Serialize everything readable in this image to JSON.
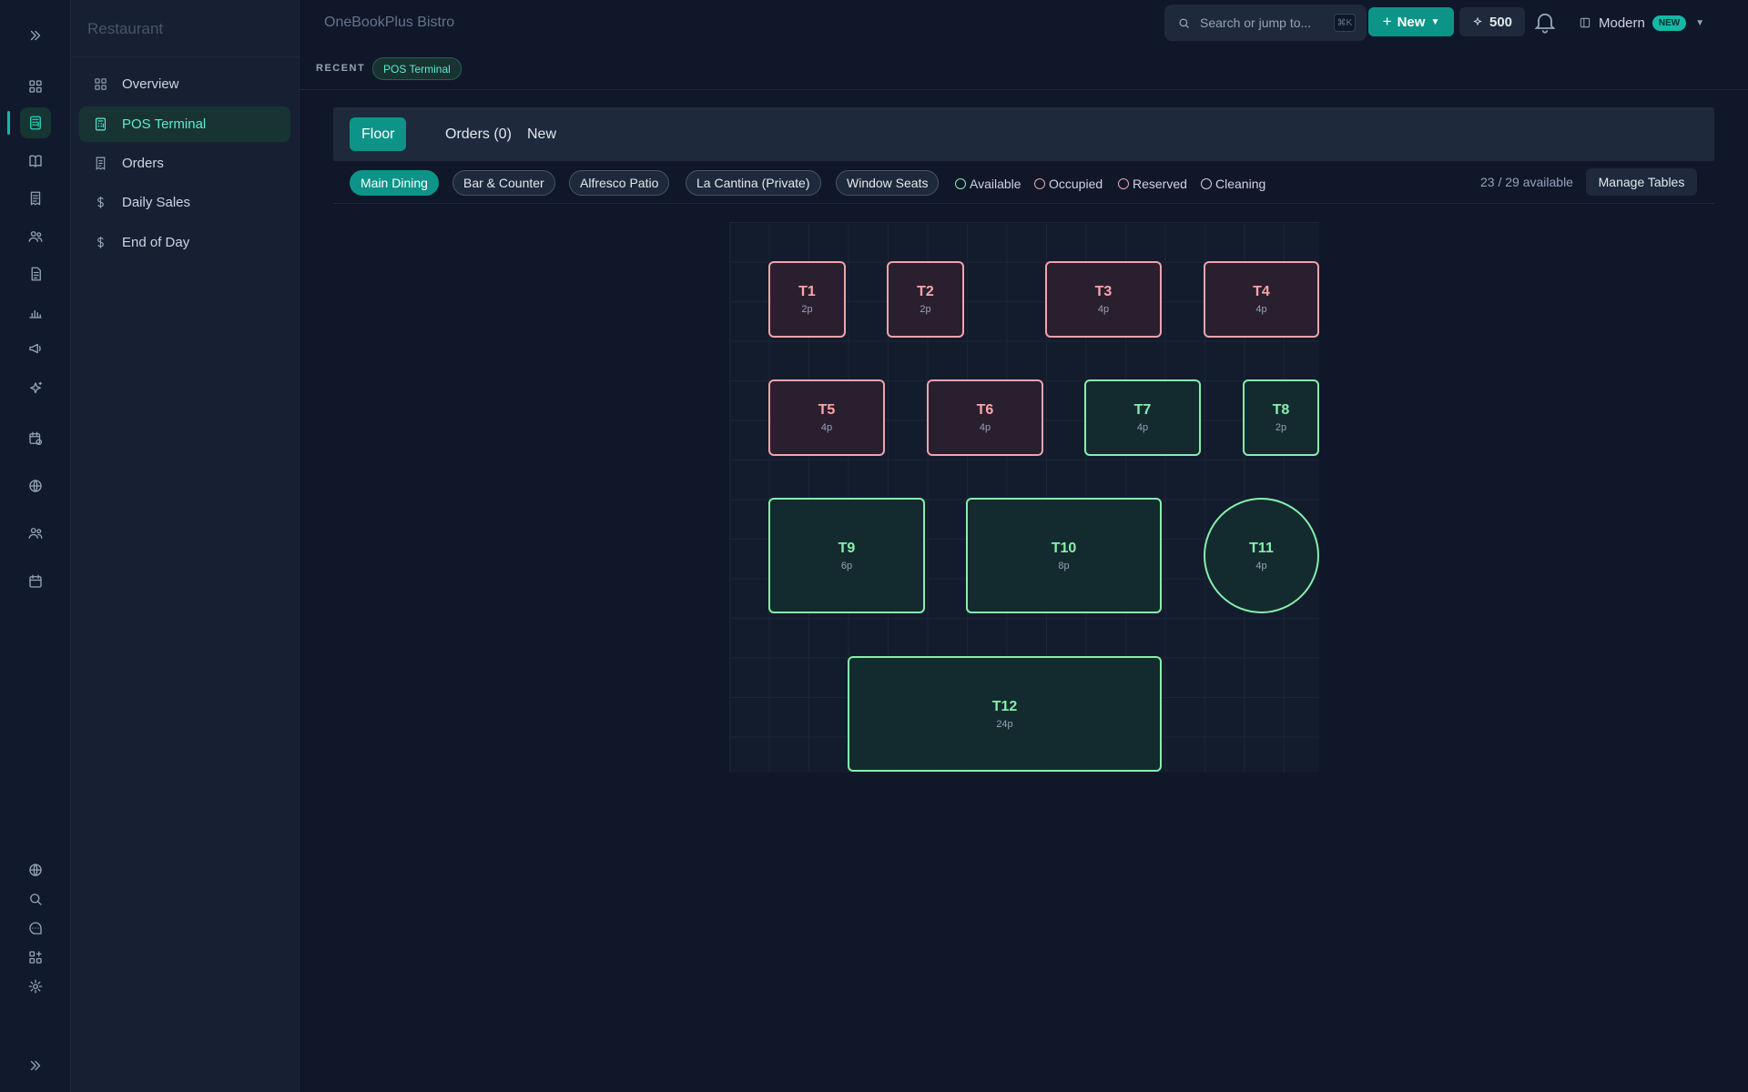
{
  "app": {
    "section_title": "Restaurant",
    "brand": "OneBookPlus Bistro"
  },
  "rail": {
    "top_icons": [
      "expand-icon",
      "grid-icon",
      "calculator-icon",
      "book-icon",
      "receipt-icon",
      "users-icon",
      "document-icon",
      "bar-chart-icon",
      "megaphone-icon",
      "sparkles-icon",
      "calendar-clock-icon",
      "globe-icon",
      "team-icon",
      "calendar-icon"
    ],
    "bottom_icons": [
      "globe-icon",
      "search-icon",
      "chat-icon",
      "apps-icon",
      "gear-icon",
      "expand-icon"
    ],
    "active": "calculator-icon"
  },
  "sidebar": {
    "items": [
      {
        "label": "Overview",
        "icon": "grid-icon"
      },
      {
        "label": "POS Terminal",
        "icon": "calculator-icon",
        "active": true
      },
      {
        "label": "Orders",
        "icon": "receipt-icon"
      },
      {
        "label": "Daily Sales",
        "icon": "dollar-icon"
      },
      {
        "label": "End of Day",
        "icon": "dollar-icon"
      }
    ]
  },
  "topbar": {
    "search_placeholder": "Search or jump to...",
    "search_shortcut": "⌘K",
    "new_label": "New",
    "credits": "500",
    "theme_label": "Modern",
    "theme_badge": "NEW"
  },
  "recent": {
    "label": "RECENT",
    "chip": "POS Terminal"
  },
  "tabs": [
    {
      "label": "Floor",
      "active": true
    },
    {
      "label": "Orders (0)"
    },
    {
      "label": "New"
    }
  ],
  "zones": [
    {
      "label": "Main Dining",
      "active": true
    },
    {
      "label": "Bar & Counter"
    },
    {
      "label": "Alfresco Patio"
    },
    {
      "label": "La Cantina (Private)"
    },
    {
      "label": "Window Seats"
    }
  ],
  "legend": [
    {
      "label": "Available",
      "color": "#86efac"
    },
    {
      "label": "Occupied",
      "color": "#f0a3ad"
    },
    {
      "label": "Reserved",
      "color": "#f0a3ad"
    },
    {
      "label": "Cleaning",
      "color": "#cbd5e1"
    }
  ],
  "availability": "23 / 29 available",
  "manage_tables_label": "Manage Tables",
  "colors": {
    "accent": "#0d9488",
    "available": "#86efac",
    "occupied": "#f0a3ad"
  },
  "tables": [
    {
      "name": "T1",
      "capacity": "2p",
      "status": "occupied",
      "shape": "rect"
    },
    {
      "name": "T2",
      "capacity": "2p",
      "status": "occupied",
      "shape": "rect"
    },
    {
      "name": "T3",
      "capacity": "4p",
      "status": "occupied",
      "shape": "rect"
    },
    {
      "name": "T4",
      "capacity": "4p",
      "status": "occupied",
      "shape": "rect"
    },
    {
      "name": "T5",
      "capacity": "4p",
      "status": "occupied",
      "shape": "rect"
    },
    {
      "name": "T6",
      "capacity": "4p",
      "status": "occupied",
      "shape": "rect"
    },
    {
      "name": "T7",
      "capacity": "4p",
      "status": "available",
      "shape": "rect"
    },
    {
      "name": "T8",
      "capacity": "2p",
      "status": "available",
      "shape": "rect"
    },
    {
      "name": "T9",
      "capacity": "6p",
      "status": "available",
      "shape": "rect"
    },
    {
      "name": "T10",
      "capacity": "8p",
      "status": "available",
      "shape": "rect"
    },
    {
      "name": "T11",
      "capacity": "4p",
      "status": "available",
      "shape": "round"
    },
    {
      "name": "T12",
      "capacity": "24p",
      "status": "available",
      "shape": "rect"
    }
  ]
}
